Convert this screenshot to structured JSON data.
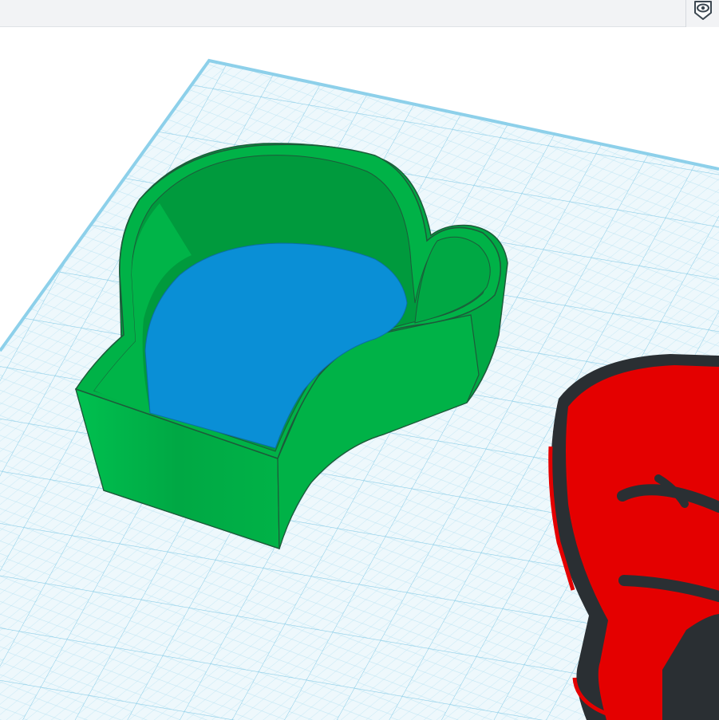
{
  "toolbar": {
    "view_toggle_icon": "eye-icon"
  },
  "scene": {
    "workplane": {
      "grid_color": "#a9dcef",
      "major_grid_color": "#7cc6e3"
    },
    "objects": [
      {
        "name": "cookie-cutter-glove",
        "color": "#00b247",
        "inner_color": "#0a8fd6"
      },
      {
        "name": "boxing-glove-stamp",
        "color": "#e40000",
        "outline_color": "#2a2f33"
      }
    ]
  },
  "colors": {
    "toolbar_bg": "#f2f3f5",
    "icon": "#3b4650",
    "green": "#00b247",
    "blue": "#0a8fd6",
    "red": "#e40000",
    "dark": "#2a2f33"
  }
}
